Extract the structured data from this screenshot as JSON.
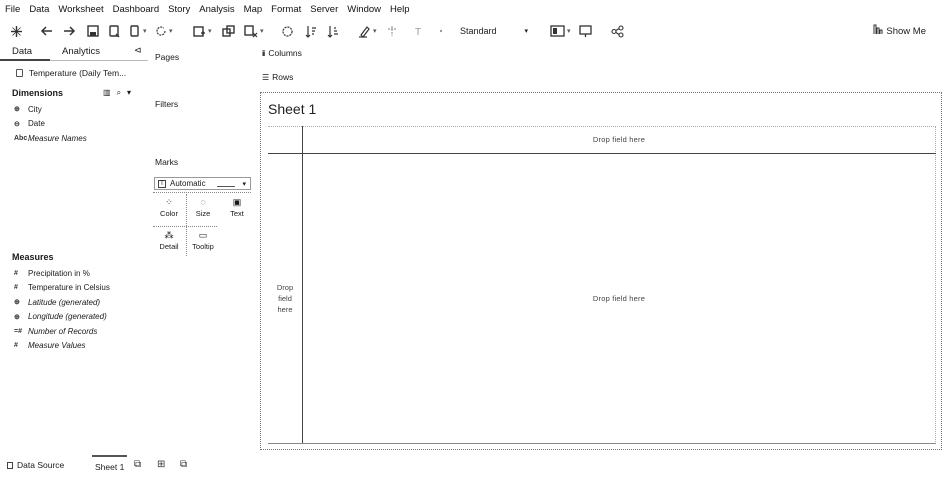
{
  "menu": [
    "File",
    "Data",
    "Worksheet",
    "Dashboard",
    "Story",
    "Analysis",
    "Map",
    "Format",
    "Server",
    "Window",
    "Help"
  ],
  "toolbar": {
    "fit_value": "Standard",
    "show_me_label": "Show Me"
  },
  "data_pane": {
    "tabs": [
      "Data",
      "Analytics"
    ],
    "datasource_name": "Temperature (Daily Tem...",
    "dimensions_title": "Dimensions",
    "dimensions": [
      {
        "icon": "globe-icon",
        "glyph": "⊕",
        "label": "City",
        "italic": false
      },
      {
        "icon": "calendar-icon",
        "glyph": "⊖",
        "label": "Date",
        "italic": false
      },
      {
        "icon": "abc-icon",
        "glyph": "Abc",
        "label": "Measure Names",
        "italic": true
      }
    ],
    "measures_title": "Measures",
    "measures": [
      {
        "icon": "hash-icon",
        "glyph": "#",
        "label": "Precipitation in %",
        "italic": false
      },
      {
        "icon": "hash-icon",
        "glyph": "#",
        "label": "Temperature in Celsius",
        "italic": false
      },
      {
        "icon": "globe-icon",
        "glyph": "⊕",
        "label": "Latitude (generated)",
        "italic": true
      },
      {
        "icon": "globe-icon",
        "glyph": "⊕",
        "label": "Longitude (generated)",
        "italic": true
      },
      {
        "icon": "hash-icon",
        "glyph": "=#",
        "label": "Number of Records",
        "italic": true
      },
      {
        "icon": "hash-icon",
        "glyph": "#",
        "label": "Measure Values",
        "italic": true
      }
    ]
  },
  "shelves": {
    "pages": "Pages",
    "filters": "Filters",
    "marks": "Marks",
    "marks_type": "Automatic",
    "columns": "Columns",
    "rows": "Rows"
  },
  "marks_buttons": {
    "color": "Color",
    "size": "Size",
    "text": "Text",
    "detail": "Detail",
    "tooltip": "Tooltip"
  },
  "view": {
    "sheet_title": "Sheet 1",
    "drop_columns": "Drop field here",
    "drop_rows": "Drop\nfield\nhere",
    "drop_center": "Drop field here"
  },
  "bottom": {
    "datasource_tab": "Data Source",
    "sheet_tab": "Sheet 1"
  }
}
